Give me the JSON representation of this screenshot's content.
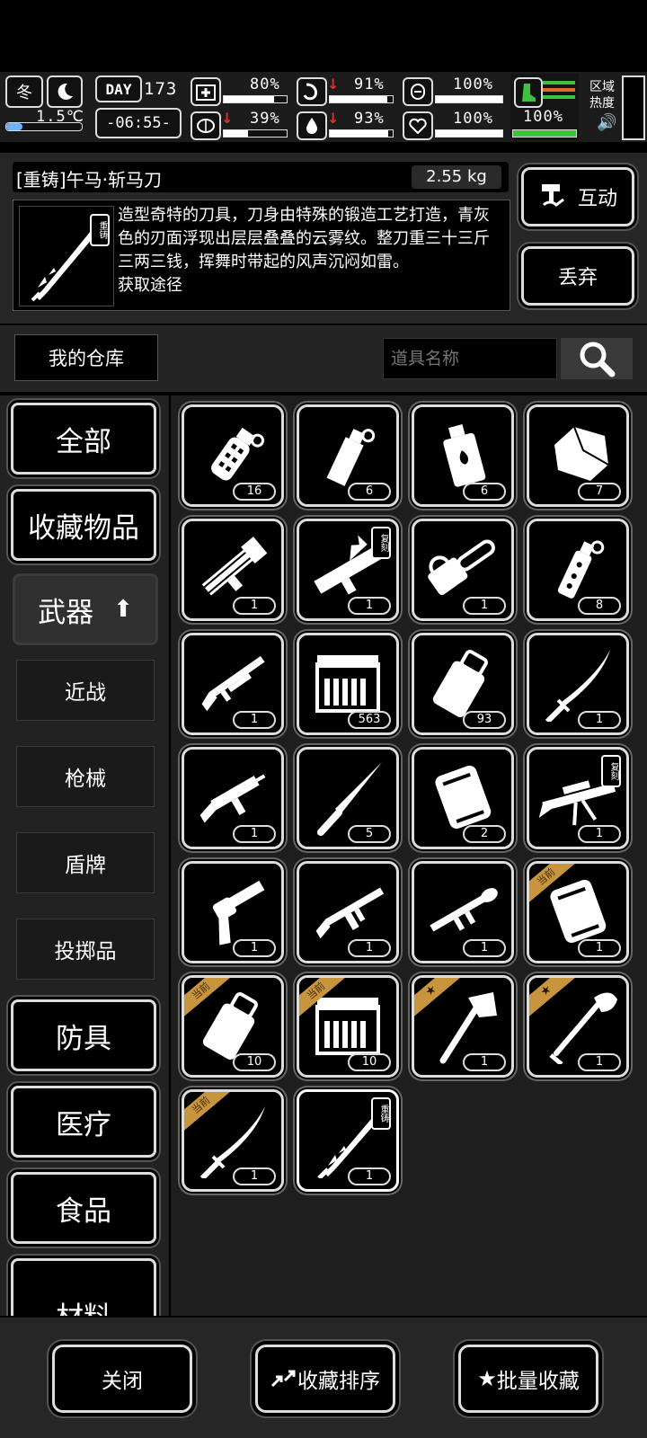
{
  "status": {
    "season": "冬",
    "temperature": "1.5℃",
    "day_label": "DAY",
    "day": "173",
    "time": "-06:55-",
    "stats": [
      {
        "name": "health",
        "value": "80%",
        "level": 0.8
      },
      {
        "name": "hunger",
        "value": "91%",
        "level": 0.91,
        "trend": "down"
      },
      {
        "name": "oxygen",
        "value": "100%",
        "level": 1.0
      },
      {
        "name": "mood",
        "value": "39%",
        "level": 0.39,
        "trend": "down"
      },
      {
        "name": "thirst",
        "value": "93%",
        "level": 0.93,
        "trend": "down"
      },
      {
        "name": "heart",
        "value": "100%",
        "level": 1.0
      }
    ],
    "stamina": "100%",
    "area_heat": "区域\n热度"
  },
  "item": {
    "title": "[重铸]午马·斩马刀",
    "weight": "2.55 kg",
    "badge": "重铸",
    "description": "造型奇特的刀具，刀身由特殊的锻造工艺打造，青灰色的刃面浮现出层层叠叠的云雾纹。整刀重三十三斤三两三钱，挥舞时带起的风声沉闷如雷。\n获取途径",
    "interact_label": "互动",
    "discard_label": "丢弃"
  },
  "warehouse": {
    "label": "我的仓库",
    "search_placeholder": "道具名称"
  },
  "categories": [
    {
      "label": "全部"
    },
    {
      "label": "收藏物品"
    },
    {
      "label": "武器",
      "active": true
    },
    {
      "label": "近战",
      "sub": true
    },
    {
      "label": "枪械",
      "sub": true
    },
    {
      "label": "盾牌",
      "sub": true
    },
    {
      "label": "投掷品",
      "sub": true
    },
    {
      "label": "防具"
    },
    {
      "label": "医疗"
    },
    {
      "label": "食品"
    },
    {
      "label": "材料"
    }
  ],
  "items": [
    {
      "icon": "grenade-icon",
      "count": "16"
    },
    {
      "icon": "flashbang-icon",
      "count": "6"
    },
    {
      "icon": "fire-grenade-icon",
      "count": "6"
    },
    {
      "icon": "rock-icon",
      "count": "7"
    },
    {
      "icon": "minigun-icon",
      "count": "1"
    },
    {
      "icon": "dragon-cannon-icon",
      "count": "1",
      "badge": "复刻"
    },
    {
      "icon": "chainsaw-icon",
      "count": "1"
    },
    {
      "icon": "smoke-grenade-icon",
      "count": "8"
    },
    {
      "icon": "shotgun-icon",
      "count": "1"
    },
    {
      "icon": "ammo-box-icon",
      "count": "563"
    },
    {
      "icon": "ammo-pouch-icon",
      "count": "93"
    },
    {
      "icon": "katana-icon",
      "count": "1"
    },
    {
      "icon": "smg-icon",
      "count": "1"
    },
    {
      "icon": "knife-icon",
      "count": "5"
    },
    {
      "icon": "shield-plate-icon",
      "count": "2"
    },
    {
      "icon": "dragon-sniper-icon",
      "count": "1",
      "badge": "复刻"
    },
    {
      "icon": "revolver-icon",
      "count": "1"
    },
    {
      "icon": "rifle-icon",
      "count": "1"
    },
    {
      "icon": "rpg-icon",
      "count": "1"
    },
    {
      "icon": "shield-plate-icon",
      "count": "1",
      "ribbon": "当前"
    },
    {
      "icon": "ammo-pouch-icon",
      "count": "10",
      "ribbon": "当前"
    },
    {
      "icon": "ammo-box-icon",
      "count": "10",
      "ribbon": "当前"
    },
    {
      "icon": "axe-icon",
      "count": "1",
      "ribbon": "★"
    },
    {
      "icon": "shovel-icon",
      "count": "1",
      "ribbon": "★"
    },
    {
      "icon": "katana-icon",
      "count": "1",
      "ribbon": "当前"
    },
    {
      "icon": "zhanma-blade-icon",
      "count": "1",
      "badge": "重铸"
    }
  ],
  "bottom": {
    "close_label": "关闭",
    "sort_label": "收藏排序",
    "batch_label": "批量收藏"
  },
  "colors": {
    "accent_gold": "#c7953e",
    "stamina_green": "#3ec13e",
    "stress_red": "#e03030"
  }
}
